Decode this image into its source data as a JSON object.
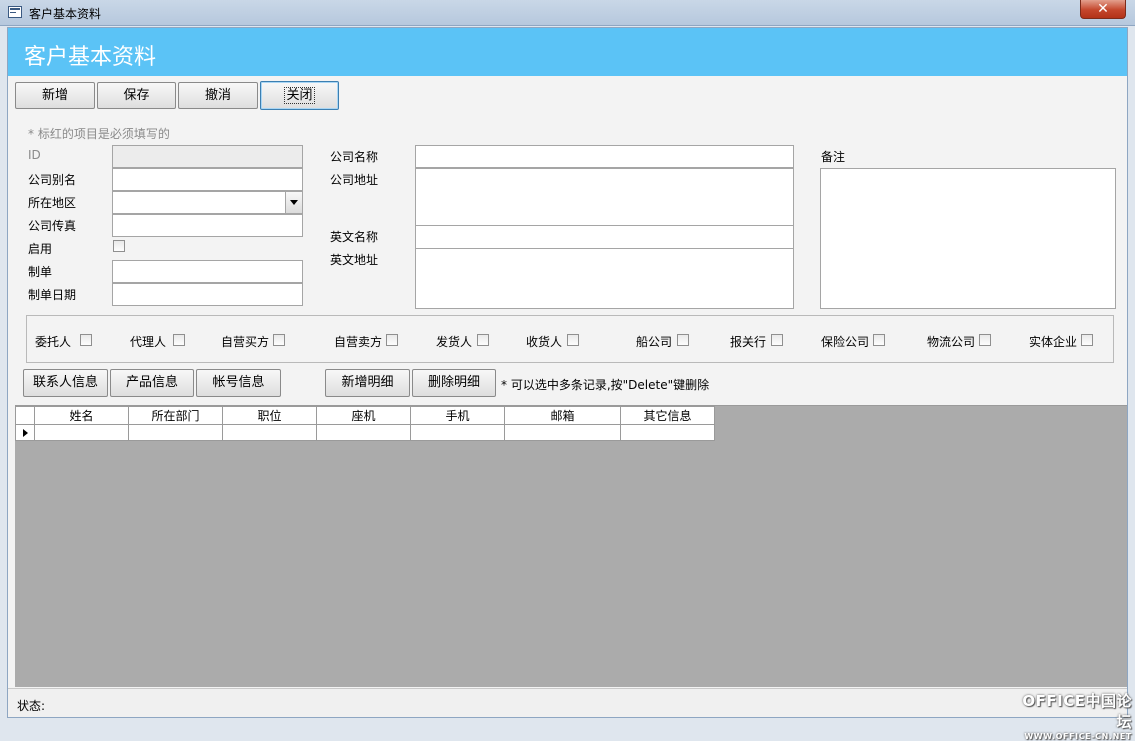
{
  "window": {
    "title": "客户基本资料"
  },
  "header": {
    "title": "客户基本资料"
  },
  "toolbar": {
    "new_label": "新增",
    "save_label": "保存",
    "undo_label": "撤消",
    "close_label": "关闭"
  },
  "form": {
    "required_note": "* 标红的项目是必须填写的",
    "labels": {
      "id": "ID",
      "alias": "公司别名",
      "region": "所在地区",
      "fax": "公司传真",
      "enabled": "启用",
      "maker": "制单",
      "make_date": "制单日期",
      "company_name": "公司名称",
      "company_address": "公司地址",
      "english_name": "英文名称",
      "english_address": "英文地址",
      "remarks": "备注"
    }
  },
  "roles": [
    "委托人",
    "代理人",
    "自营买方",
    "自营卖方",
    "发货人",
    "收货人",
    "船公司",
    "报关行",
    "保险公司",
    "物流公司",
    "实体企业"
  ],
  "tabs": {
    "contacts_label": "联系人信息",
    "products_label": "产品信息",
    "accounts_label": "帐号信息",
    "add_detail_label": "新增明细",
    "delete_detail_label": "删除明细",
    "hint": "* 可以选中多条记录,按\"Delete\"键删除"
  },
  "grid": {
    "columns": [
      "姓名",
      "所在部门",
      "职位",
      "座机",
      "手机",
      "邮箱",
      "其它信息"
    ]
  },
  "status": {
    "label": "状态:"
  },
  "watermark": {
    "line1": "OFFICE中国论坛",
    "line2": "WWW.OFFICE-CN.NET"
  }
}
